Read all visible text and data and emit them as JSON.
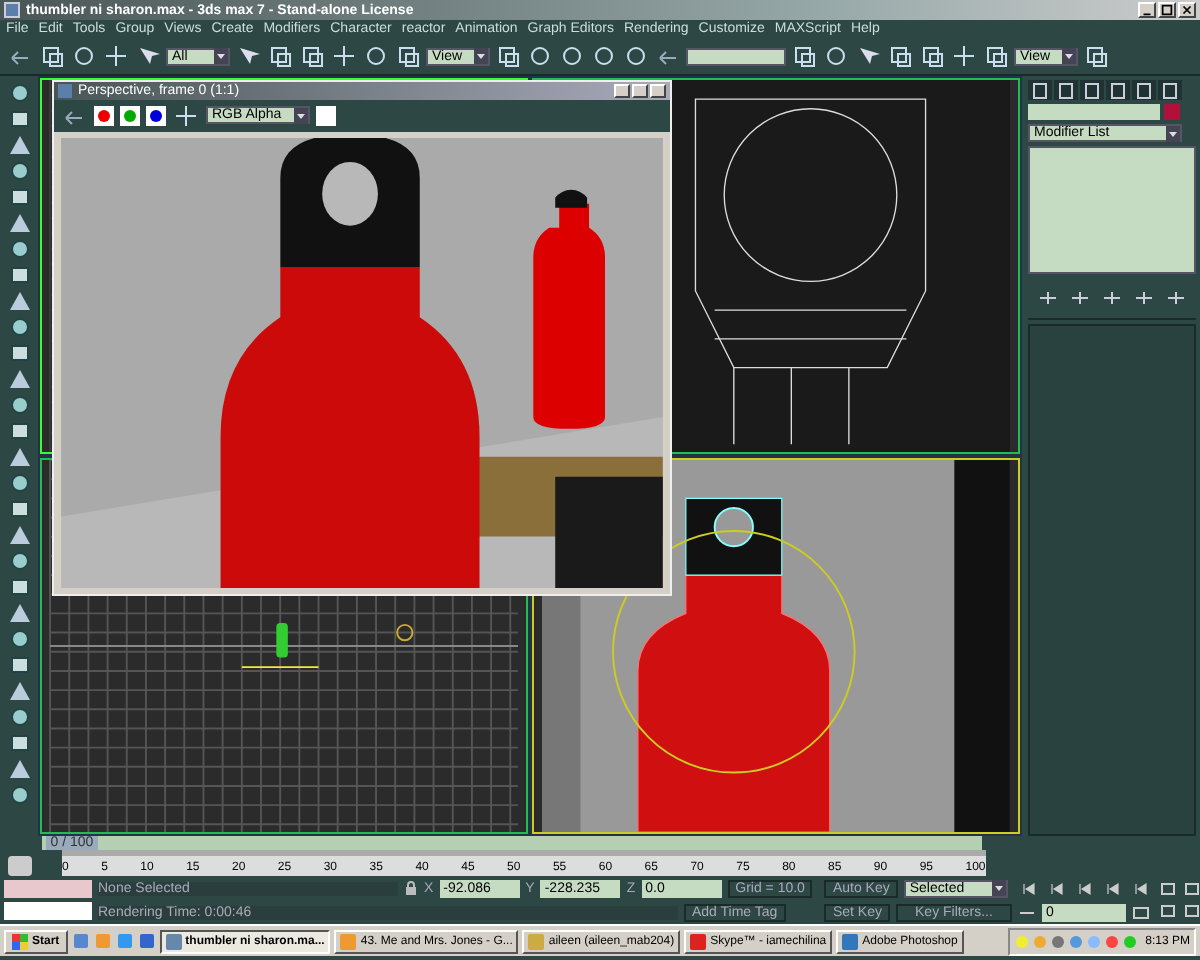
{
  "window": {
    "title": "thumbler ni sharon.max - 3ds max 7  - Stand-alone License"
  },
  "menu": [
    "File",
    "Edit",
    "Tools",
    "Group",
    "Views",
    "Create",
    "Modifiers",
    "Character",
    "reactor",
    "Animation",
    "Graph Editors",
    "Rendering",
    "Customize",
    "MAXScript",
    "Help"
  ],
  "toolbar": {
    "selection_filter": "All",
    "reference_coord": "View",
    "view_dropdown": "View"
  },
  "render_window": {
    "title": "Perspective, frame 0 (1:1)",
    "channel": "RGB Alpha"
  },
  "command_panel": {
    "modifier_list": "Modifier List"
  },
  "time_slider": {
    "frame": "0 / 100",
    "level": 0,
    "ticks": [
      "0",
      "5",
      "10",
      "15",
      "20",
      "25",
      "30",
      "35",
      "40",
      "45",
      "50",
      "55",
      "60",
      "65",
      "70",
      "75",
      "80",
      "85",
      "90",
      "95",
      "100"
    ]
  },
  "status": {
    "selection": "None Selected",
    "prompt": "Rendering Time: 0:00:46",
    "coords": [
      {
        "axis": "X",
        "value": "-92.086"
      },
      {
        "axis": "Y",
        "value": "-228.235"
      },
      {
        "axis": "Z",
        "value": "0.0"
      }
    ],
    "grid": "Grid = 10.0",
    "add_time_tag": "Add Time Tag",
    "auto_key": "Auto Key",
    "set_key": "Set Key",
    "key_mode": "Selected",
    "key_filters": "Key Filters...",
    "current_frame": "0"
  },
  "taskbar": {
    "start": "Start",
    "tasks": [
      {
        "label": "thumbler ni sharon.ma...",
        "selected": true
      },
      {
        "label": "43. Me and Mrs. Jones - G...",
        "selected": false
      },
      {
        "label": "aileen (aileen_mab204)",
        "selected": false
      },
      {
        "label": "Skype™ - iamechilina",
        "selected": false
      },
      {
        "label": "Adobe Photoshop",
        "selected": false
      }
    ],
    "clock": "8:13 PM"
  }
}
